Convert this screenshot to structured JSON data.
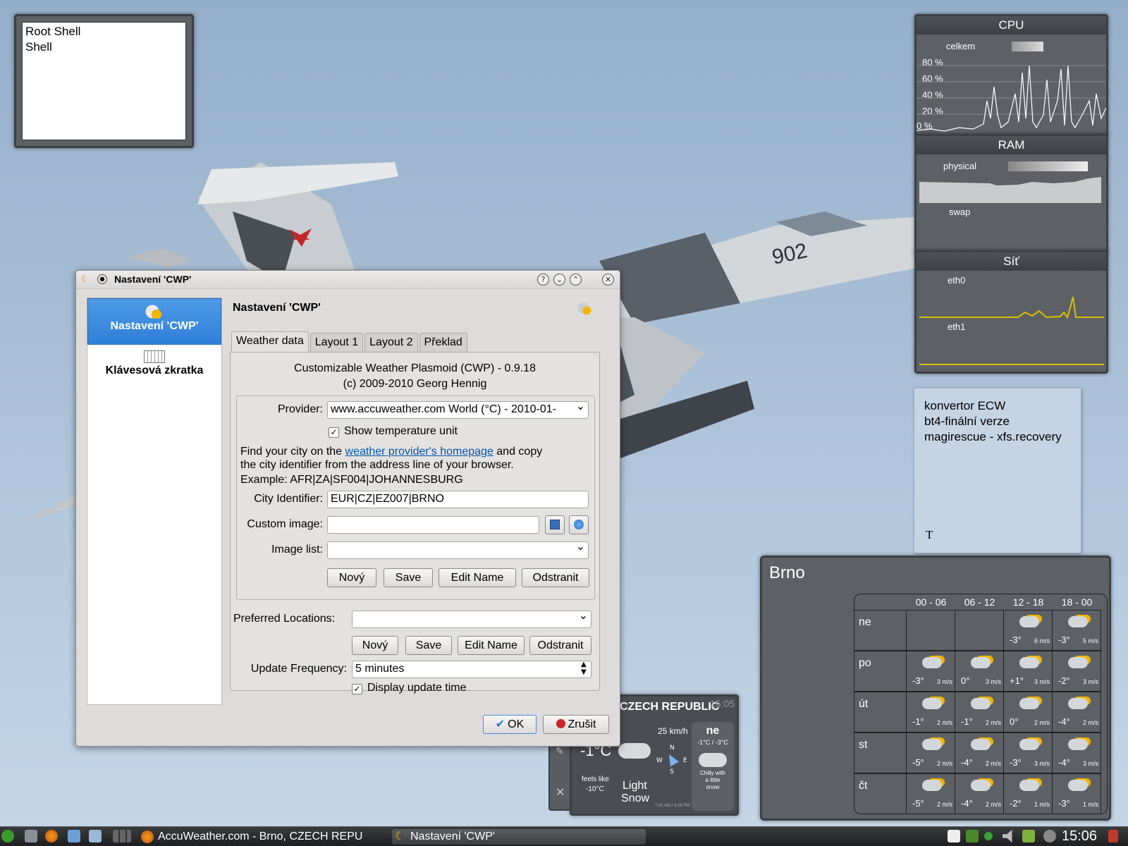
{
  "desktop": {
    "folder_widget": {
      "items": [
        "Root Shell",
        "Shell"
      ]
    },
    "cpu": {
      "title": "CPU",
      "label": "celkem",
      "ticks": [
        "80 %",
        "60 %",
        "40 %",
        "20 %",
        "0 %"
      ]
    },
    "ram": {
      "title": "RAM",
      "physical": "physical",
      "swap": "swap"
    },
    "net": {
      "title": "Síť",
      "eth0": "eth0",
      "eth1": "eth1"
    },
    "notes": {
      "lines": [
        "konvertor ECW",
        "bt4-finální verze",
        "magirescue - xfs.recovery"
      ]
    },
    "jet_number": "902",
    "small_weather": {
      "header": "CZECH REPUBLIC",
      "time": "15:05",
      "wind": "25 km/h",
      "temp": "-1°C",
      "feels": "feels like",
      "feels_val": "-10°C",
      "cond": "Light",
      "cond2": "Snow",
      "day": "ne",
      "range": "-1°C / -3°C",
      "desc": [
        "Chilly with",
        "a little",
        "snow"
      ],
      "compass": [
        "N",
        "W",
        "E",
        "S"
      ],
      "sun": "7:41 AM / 4:26 PM"
    },
    "brno_weather": {
      "city": "Brno",
      "columns": [
        "00 - 06",
        "06 - 12",
        "12 - 18",
        "18 - 00"
      ],
      "rows": [
        {
          "day": "ne",
          "cells": [
            null,
            null,
            {
              "t": "-3°",
              "w": "6 m/s"
            },
            {
              "t": "-3°",
              "w": "5 m/s"
            }
          ]
        },
        {
          "day": "po",
          "cells": [
            {
              "t": "-3°",
              "w": "3 m/s"
            },
            {
              "t": "0°",
              "w": "3 m/s"
            },
            {
              "t": "+1°",
              "w": "3 m/s"
            },
            {
              "t": "-2°",
              "w": "3 m/s"
            }
          ]
        },
        {
          "day": "út",
          "cells": [
            {
              "t": "-1°",
              "w": "2 m/s"
            },
            {
              "t": "-1°",
              "w": "2 m/s"
            },
            {
              "t": "0°",
              "w": "2 m/s"
            },
            {
              "t": "-4°",
              "w": "2 m/s"
            }
          ]
        },
        {
          "day": "st",
          "cells": [
            {
              "t": "-5°",
              "w": "2 m/s"
            },
            {
              "t": "-4°",
              "w": "2 m/s"
            },
            {
              "t": "-3°",
              "w": "3 m/s"
            },
            {
              "t": "-4°",
              "w": "3 m/s"
            }
          ]
        },
        {
          "day": "čt",
          "cells": [
            {
              "t": "-5°",
              "w": "2 m/s"
            },
            {
              "t": "-4°",
              "w": "2 m/s"
            },
            {
              "t": "-2°",
              "w": "1 m/s"
            },
            {
              "t": "-3°",
              "w": "1 m/s"
            }
          ]
        }
      ]
    }
  },
  "dialog": {
    "window_title": "Nastavení 'CWP'",
    "sidebar": [
      {
        "label": "Nastavení 'CWP'",
        "selected": true
      },
      {
        "label": "Klávesová zkratka",
        "selected": false
      }
    ],
    "page_title": "Nastavení 'CWP'",
    "tabs": [
      {
        "label": "Weather data",
        "active": true
      },
      {
        "label": "Layout 1"
      },
      {
        "label": "Layout 2"
      },
      {
        "label": "Překlad"
      }
    ],
    "about_line1": "Customizable Weather Plasmoid (CWP) - 0.9.18",
    "about_line2": "(c) 2009-2010 Georg Hennig",
    "provider_label": "Provider:",
    "provider_value": "www.accuweather.com World (°C) - 2010-01-",
    "show_unit_label": "Show temperature unit",
    "show_unit_checked": true,
    "find_text_1": "Find your city on the",
    "find_link": "weather provider's homepage",
    "find_text_2": "and copy",
    "find_text_3": "the city identifier from the address line of your browser.",
    "example": "Example: AFR|ZA|SF004|JOHANNESBURG",
    "city_label": "City Identifier:",
    "city_value": "EUR|CZ|EZ007|BRNO",
    "custom_image_label": "Custom image:",
    "custom_image_value": "",
    "image_list_label": "Image list:",
    "image_list_value": "",
    "btn_new": "Nový",
    "btn_save": "Save",
    "btn_edit": "Edit Name",
    "btn_remove": "Odstranit",
    "pref_label": "Preferred Locations:",
    "pref_value": "",
    "update_label": "Update Frequency:",
    "update_value": "5 minutes",
    "display_time_label": "Display update time",
    "display_time_checked": true,
    "ok": "OK",
    "cancel": "Zrušit"
  },
  "taskbar": {
    "tasks": [
      "AccuWeather.com - Brno, CZECH REPU",
      "Nastavení 'CWP'"
    ],
    "clock": "15:06"
  },
  "colors": {
    "accent": "#3f8ddf",
    "link": "#0057ae",
    "panel": "#5d6166",
    "net_line": "#d9c000"
  }
}
